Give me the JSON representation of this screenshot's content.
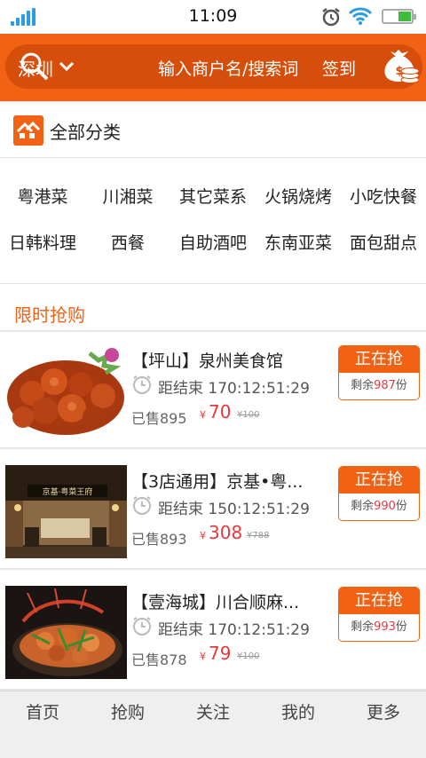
{
  "status_bar": {
    "time": "11:09"
  },
  "header": {
    "city": "深圳",
    "search_placeholder": "输入商户名/搜索词",
    "signin_label": "签到",
    "accent_color": "#f26215"
  },
  "category": {
    "title": "全部分类",
    "items": [
      "粤港菜",
      "川湘菜",
      "其它菜系",
      "火锅烧烤",
      "小吃快餐",
      "日韩料理",
      "西餐",
      "自助酒吧",
      "东南亚菜",
      "面包甜点"
    ]
  },
  "flash_sale": {
    "title": "限时抢购",
    "deals": [
      {
        "name": "【坪山】泉州美食馆",
        "countdown": "距结束 170:12:51:29",
        "sold": "已售895",
        "currency": "¥",
        "price": "70",
        "original_price": "¥100",
        "button": "正在抢",
        "remain_prefix": "剩余",
        "remain_count": "987",
        "remain_unit": "份"
      },
      {
        "name": "【3店通用】京基•粤...",
        "countdown": "距结束 150:12:51:29",
        "sold": "已售893",
        "currency": "¥",
        "price": "308",
        "original_price": "¥788",
        "button": "正在抢",
        "remain_prefix": "剩余",
        "remain_count": "990",
        "remain_unit": "份"
      },
      {
        "name": "【壹海城】川合顺麻...",
        "countdown": "距结束 170:12:51:29",
        "sold": "已售878",
        "currency": "¥",
        "price": "79",
        "original_price": "¥100",
        "button": "正在抢",
        "remain_prefix": "剩余",
        "remain_count": "993",
        "remain_unit": "份"
      }
    ]
  },
  "tabbar": {
    "items": [
      "首页",
      "抢购",
      "关注",
      "我的",
      "更多"
    ]
  }
}
